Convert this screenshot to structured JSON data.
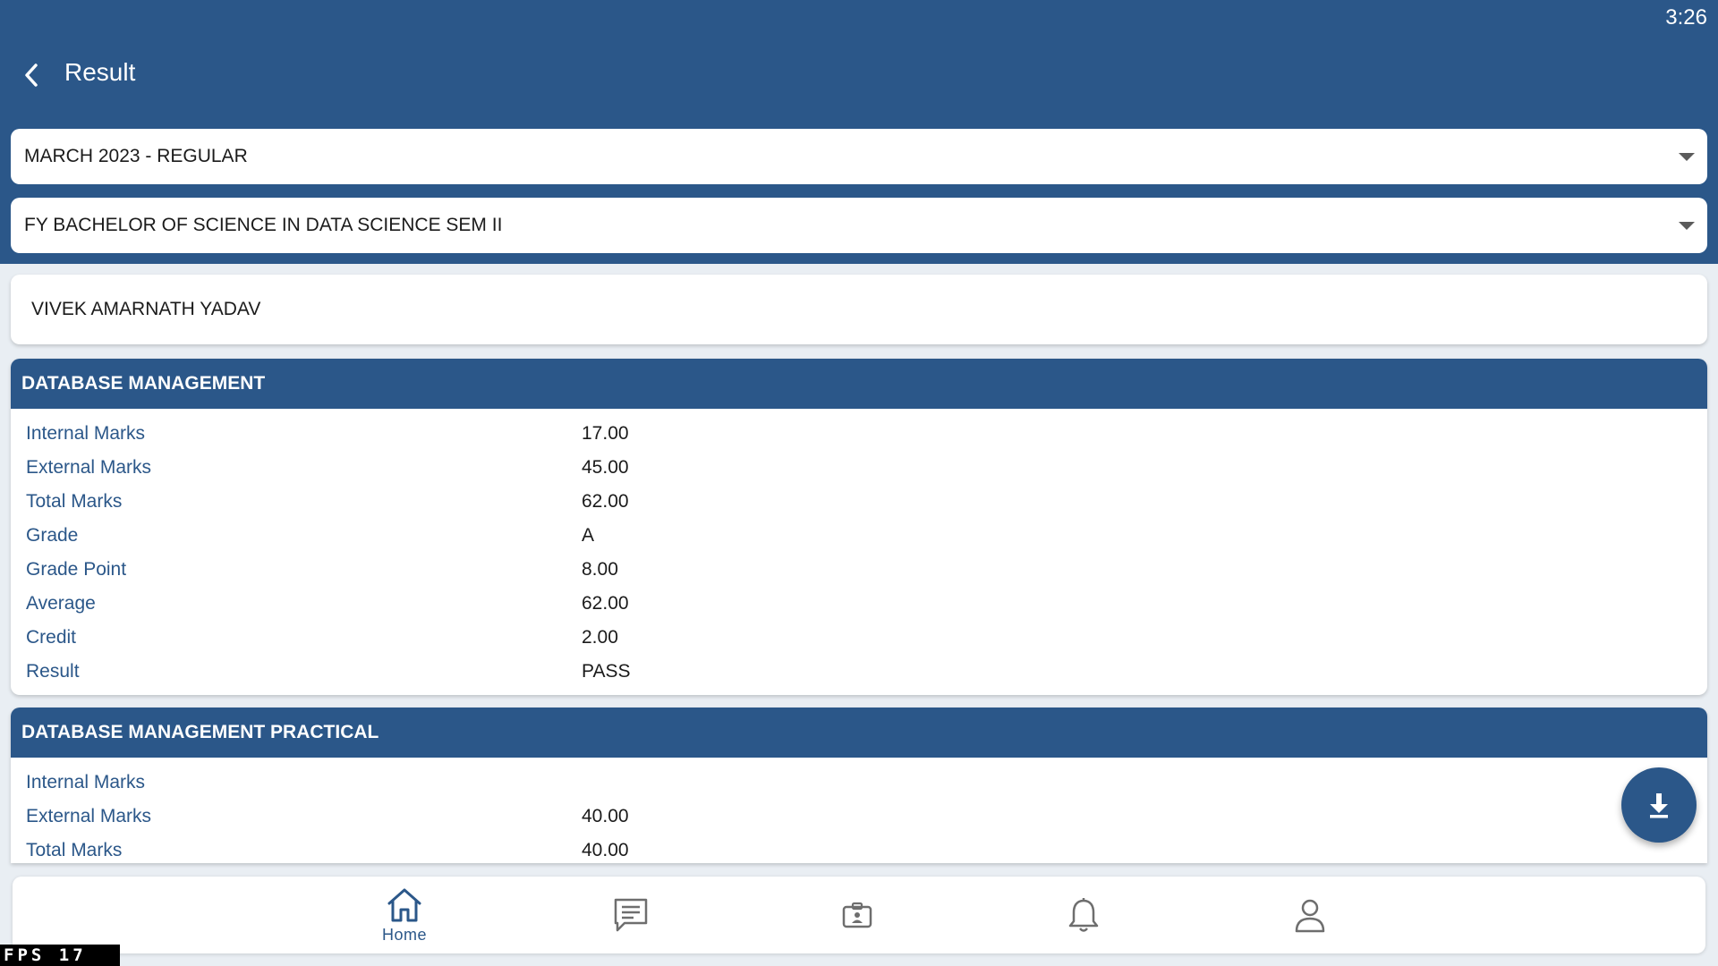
{
  "status_bar": {
    "time": "3:26"
  },
  "header": {
    "title": "Result"
  },
  "exam_select": {
    "value": "MARCH 2023 - REGULAR"
  },
  "course_select": {
    "value": "FY BACHELOR OF SCIENCE IN DATA SCIENCE SEM II"
  },
  "student": {
    "name": "VIVEK AMARNATH YADAV"
  },
  "subjects": [
    {
      "title": "DATABASE MANAGEMENT",
      "rows": [
        {
          "label": "Internal Marks",
          "value": "17.00"
        },
        {
          "label": "External Marks",
          "value": "45.00"
        },
        {
          "label": "Total Marks",
          "value": "62.00"
        },
        {
          "label": "Grade",
          "value": "A"
        },
        {
          "label": "Grade Point",
          "value": "8.00"
        },
        {
          "label": "Average",
          "value": "62.00"
        },
        {
          "label": "Credit",
          "value": "2.00"
        },
        {
          "label": "Result",
          "value": "PASS"
        }
      ]
    },
    {
      "title": "DATABASE MANAGEMENT PRACTICAL",
      "rows": [
        {
          "label": "Internal Marks",
          "value": ""
        },
        {
          "label": "External Marks",
          "value": "40.00"
        },
        {
          "label": "Total Marks",
          "value": "40.00"
        }
      ]
    }
  ],
  "bottom_nav": {
    "items": [
      {
        "label": "Home",
        "icon": "home-icon",
        "active": true
      },
      {
        "label": "",
        "icon": "chat-icon",
        "active": false
      },
      {
        "label": "",
        "icon": "id-card-icon",
        "active": false
      },
      {
        "label": "",
        "icon": "bell-icon",
        "active": false
      },
      {
        "label": "",
        "icon": "user-icon",
        "active": false
      }
    ]
  },
  "fab": {
    "icon": "download-icon"
  },
  "overlay": {
    "fps": "FPS 17"
  },
  "colors": {
    "primary": "#2b5789",
    "background": "#e9eef3",
    "card": "#ffffff"
  }
}
